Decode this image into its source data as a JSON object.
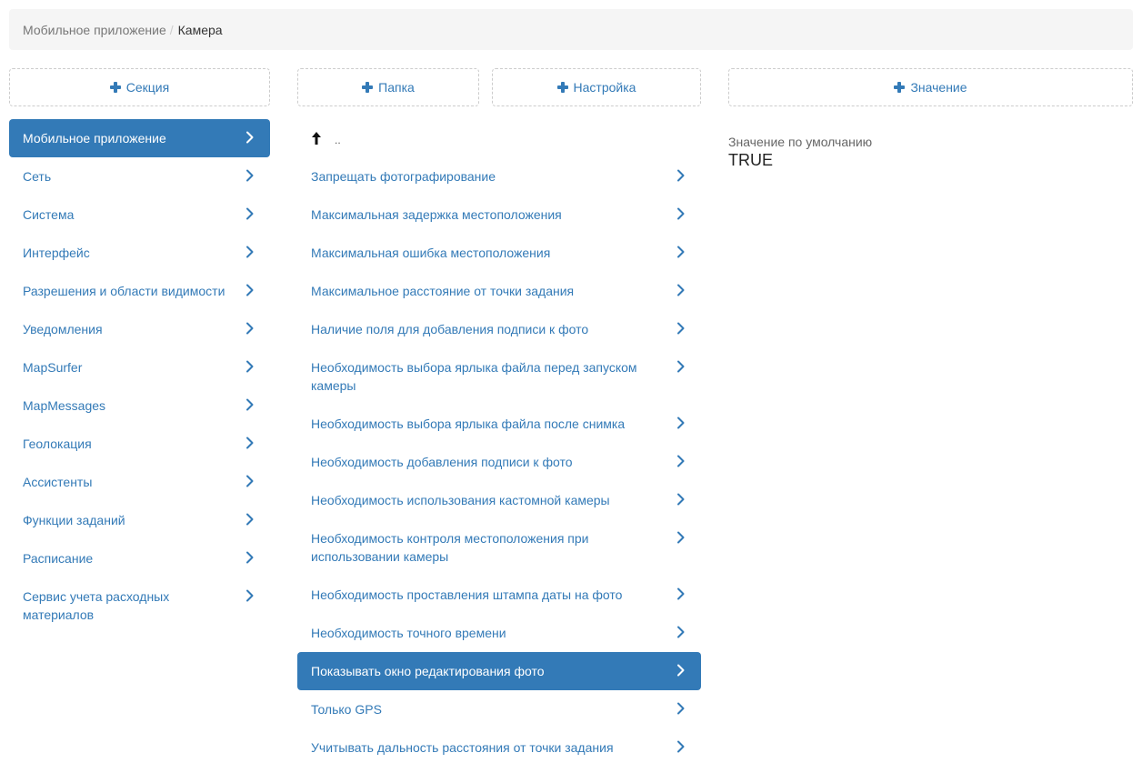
{
  "breadcrumb": {
    "parent": "Мобильное приложение",
    "separator": "/",
    "current": "Камера"
  },
  "buttons": {
    "section": "Секция",
    "folder": "Папка",
    "setting": "Настройка",
    "value": "Значение"
  },
  "sections": [
    {
      "label": "Мобильное приложение",
      "active": true
    },
    {
      "label": "Сеть",
      "active": false
    },
    {
      "label": "Система",
      "active": false
    },
    {
      "label": "Интерфейс",
      "active": false
    },
    {
      "label": "Разрешения и области видимости",
      "active": false
    },
    {
      "label": "Уведомления",
      "active": false
    },
    {
      "label": "MapSurfer",
      "active": false
    },
    {
      "label": "MapMessages",
      "active": false
    },
    {
      "label": "Геолокация",
      "active": false
    },
    {
      "label": "Ассистенты",
      "active": false
    },
    {
      "label": "Функции заданий",
      "active": false
    },
    {
      "label": "Расписание",
      "active": false
    },
    {
      "label": "Сервис учета расходных материалов",
      "active": false
    }
  ],
  "settings": {
    "up_label": "..",
    "items": [
      {
        "label": "Запрещать фотографирование",
        "active": false
      },
      {
        "label": "Максимальная задержка местоположения",
        "active": false
      },
      {
        "label": "Максимальная ошибка местоположения",
        "active": false
      },
      {
        "label": "Максимальное расстояние от точки задания",
        "active": false
      },
      {
        "label": "Наличие поля для добавления подписи к фото",
        "active": false
      },
      {
        "label": "Необходимость выбора ярлыка файла перед запуском камеры",
        "active": false
      },
      {
        "label": "Необходимость выбора ярлыка файла после снимка",
        "active": false
      },
      {
        "label": "Необходимость добавления подписи к фото",
        "active": false
      },
      {
        "label": "Необходимость использования кастомной камеры",
        "active": false
      },
      {
        "label": "Необходимость контроля местоположения при использовании камеры",
        "active": false
      },
      {
        "label": "Необходимость проставления штампа даты на фото",
        "active": false
      },
      {
        "label": "Необходимость точного времени",
        "active": false
      },
      {
        "label": "Показывать окно редактирования фото",
        "active": true
      },
      {
        "label": "Только GPS",
        "active": false
      },
      {
        "label": "Учитывать дальность расстояния от точки задания",
        "active": false
      }
    ]
  },
  "value_panel": {
    "label": "Значение по умолчанию",
    "value": "TRUE"
  },
  "colors": {
    "accent": "#337ab7",
    "breadcrumb_bg": "#f5f5f5"
  },
  "icons": {
    "add": "plus-icon",
    "navigate": "chevron-right-icon",
    "up": "arrow-up-icon"
  }
}
